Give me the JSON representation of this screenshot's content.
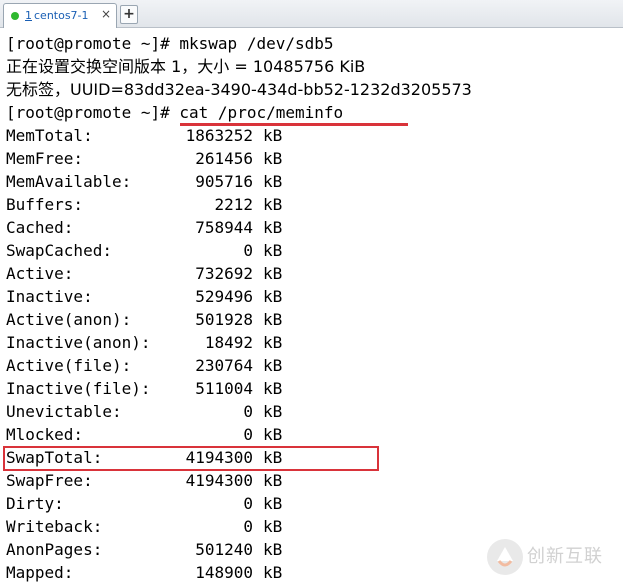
{
  "tab": {
    "number": "1",
    "name": "centos7-1",
    "close_icon": "×",
    "add_icon": "+",
    "status_color": "#2fb82f"
  },
  "terminal": {
    "prompt": "[root@promote ~]# ",
    "lines_top": [
      {
        "text": "[root@promote ~]# mkswap /dev/sdb5",
        "type": "cmd"
      },
      {
        "text": "正在设置交换空间版本 1，大小 = 10485756 KiB",
        "type": "cjk"
      },
      {
        "text": "无标签，UUID=83dd32ea-3490-434d-bb52-1232d3205573",
        "type": "cjk"
      },
      {
        "text": "[root@promote ~]# cat /proc/meminfo",
        "type": "cmd"
      }
    ],
    "meminfo": [
      {
        "key": "MemTotal:",
        "value": "1863252",
        "unit": "kB"
      },
      {
        "key": "MemFree:",
        "value": "261456",
        "unit": "kB"
      },
      {
        "key": "MemAvailable:",
        "value": "905716",
        "unit": "kB"
      },
      {
        "key": "Buffers:",
        "value": "2212",
        "unit": "kB"
      },
      {
        "key": "Cached:",
        "value": "758944",
        "unit": "kB"
      },
      {
        "key": "SwapCached:",
        "value": "0",
        "unit": "kB"
      },
      {
        "key": "Active:",
        "value": "732692",
        "unit": "kB"
      },
      {
        "key": "Inactive:",
        "value": "529496",
        "unit": "kB"
      },
      {
        "key": "Active(anon):",
        "value": "501928",
        "unit": "kB"
      },
      {
        "key": "Inactive(anon):",
        "value": "18492",
        "unit": "kB"
      },
      {
        "key": "Active(file):",
        "value": "230764",
        "unit": "kB"
      },
      {
        "key": "Inactive(file):",
        "value": "511004",
        "unit": "kB"
      },
      {
        "key": "Unevictable:",
        "value": "0",
        "unit": "kB"
      },
      {
        "key": "Mlocked:",
        "value": "0",
        "unit": "kB"
      },
      {
        "key": "SwapTotal:",
        "value": "4194300",
        "unit": "kB"
      },
      {
        "key": "SwapFree:",
        "value": "4194300",
        "unit": "kB"
      },
      {
        "key": "Dirty:",
        "value": "0",
        "unit": "kB"
      },
      {
        "key": "Writeback:",
        "value": "0",
        "unit": "kB"
      },
      {
        "key": "AnonPages:",
        "value": "501240",
        "unit": "kB"
      },
      {
        "key": "Mapped:",
        "value": "148900",
        "unit": "kB"
      }
    ],
    "highlight_color": "#d9333a"
  },
  "watermark": {
    "text": "创新互联",
    "icon": "brand-logo-icon"
  }
}
